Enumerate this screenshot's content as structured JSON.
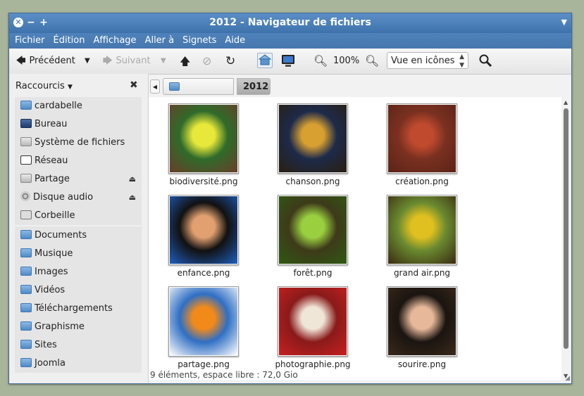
{
  "window": {
    "title": "2012 - Navigateur de fichiers",
    "close_glyph": "✕",
    "minimize_glyph": "−",
    "maximize_glyph": "+",
    "menu_glyph": "▼"
  },
  "menubar": [
    "Fichier",
    "Édition",
    "Affichage",
    "Aller à",
    "Signets",
    "Aide"
  ],
  "toolbar": {
    "back_label": "Précédent",
    "forward_label": "Suivant",
    "zoom_level": "100%",
    "view_mode": "Vue en icônes"
  },
  "sidebar": {
    "header": "Raccourcis",
    "close_glyph": "✖",
    "items": [
      {
        "label": "cardabelle",
        "icon": "home-folder-icon"
      },
      {
        "label": "Bureau",
        "icon": "desktop-icon"
      },
      {
        "label": "Système de fichiers",
        "icon": "filesystem-icon"
      },
      {
        "label": "Réseau",
        "icon": "network-icon"
      },
      {
        "label": "Partage",
        "icon": "drive-icon",
        "eject": true
      },
      {
        "label": "Disque audio",
        "icon": "audio-disc-icon",
        "eject": true
      },
      {
        "label": "Corbeille",
        "icon": "trash-icon"
      },
      {
        "label": "Documents",
        "icon": "folder-icon"
      },
      {
        "label": "Musique",
        "icon": "music-folder-icon"
      },
      {
        "label": "Images",
        "icon": "pictures-folder-icon"
      },
      {
        "label": "Vidéos",
        "icon": "videos-folder-icon"
      },
      {
        "label": "Téléchargements",
        "icon": "downloads-folder-icon"
      },
      {
        "label": "Graphisme",
        "icon": "folder-icon"
      },
      {
        "label": "Sites",
        "icon": "folder-icon"
      },
      {
        "label": "Joomla",
        "icon": "folder-icon"
      }
    ]
  },
  "pathbar": {
    "home": "cardabelle",
    "current": "2012"
  },
  "files": [
    {
      "name": "biodiversité.png",
      "colors": [
        "#6a3d2a",
        "#e8e83a",
        "#2f6b2a"
      ]
    },
    {
      "name": "chanson.png",
      "colors": [
        "#2a1f10",
        "#d8a030",
        "#1d2a4a"
      ]
    },
    {
      "name": "création.png",
      "colors": [
        "#5a2418",
        "#c04a2e",
        "#7a3020"
      ]
    },
    {
      "name": "enfance.png",
      "colors": [
        "#1f5fc0",
        "#e2a070",
        "#111111"
      ]
    },
    {
      "name": "forêt.png",
      "colors": [
        "#2e5a12",
        "#9ad040",
        "#3e3a1a"
      ]
    },
    {
      "name": "grand air.png",
      "colors": [
        "#3a2a10",
        "#e0c020",
        "#6a8a30"
      ]
    },
    {
      "name": "partage.png",
      "colors": [
        "#ffffff",
        "#f28a1a",
        "#2f6fc4"
      ]
    },
    {
      "name": "photographie.png",
      "colors": [
        "#c82020",
        "#f0e6d8",
        "#8a1a1a"
      ]
    },
    {
      "name": "sourire.png",
      "colors": [
        "#3a2a1c",
        "#e8b89a",
        "#1a1410"
      ]
    }
  ],
  "status": "9 éléments, espace libre : 72,0 Gio"
}
